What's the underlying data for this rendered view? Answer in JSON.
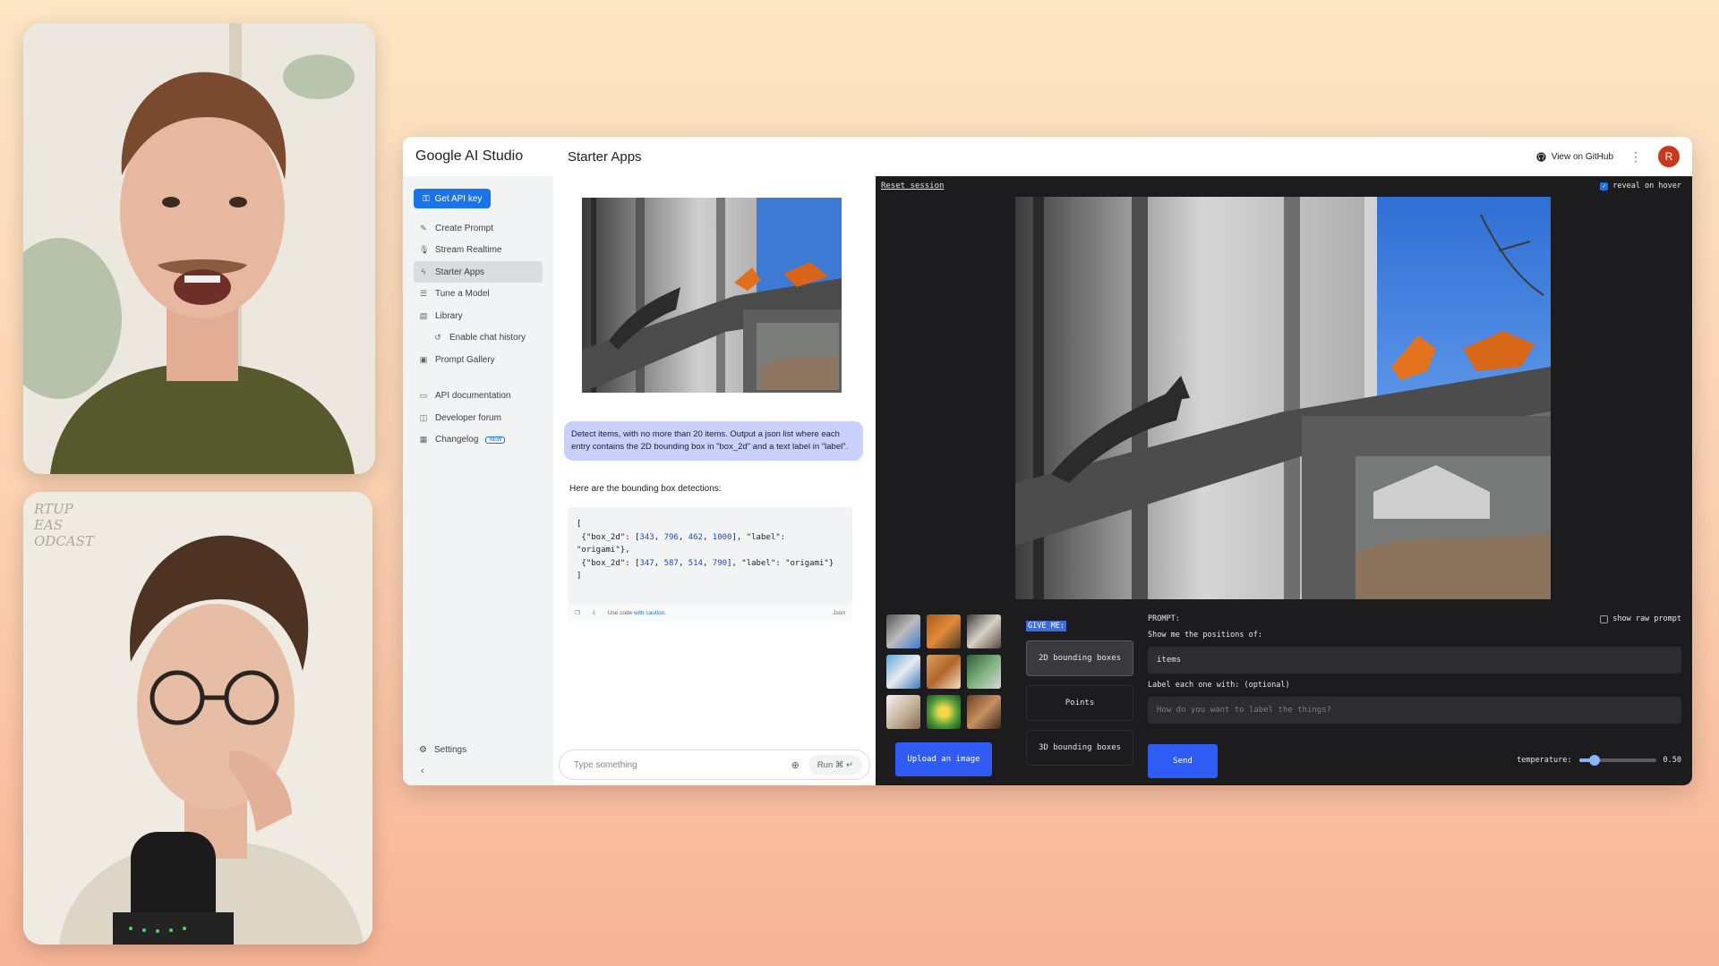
{
  "app": {
    "brand": "Google AI Studio",
    "page_title": "Starter Apps",
    "github_label": "View on GitHub",
    "avatar_initial": "R"
  },
  "sidebar": {
    "api_key_label": "Get API key",
    "items": [
      {
        "label": "Create Prompt",
        "icon": "create-prompt-icon"
      },
      {
        "label": "Stream Realtime",
        "icon": "microphone-icon"
      },
      {
        "label": "Starter Apps",
        "icon": "bolt-icon",
        "active": true
      },
      {
        "label": "Tune a Model",
        "icon": "tune-icon"
      },
      {
        "label": "Library",
        "icon": "library-icon"
      },
      {
        "label": "Enable chat history",
        "icon": "history-icon"
      },
      {
        "label": "Prompt Gallery",
        "icon": "gallery-icon"
      },
      {
        "label": "API documentation",
        "icon": "docs-icon"
      },
      {
        "label": "Developer forum",
        "icon": "forum-icon"
      },
      {
        "label": "Changelog",
        "icon": "changelog-icon",
        "badge": "NEW"
      }
    ],
    "settings_label": "Settings"
  },
  "chat": {
    "user_message": "Detect items, with no more than 20 items. Output a json list where each entry contains the 2D bounding box in \"box_2d\" and a text label in \"label\".",
    "model_intro": "Here are the bounding box detections:",
    "code": {
      "open": "[",
      "line1_pre": "{\"box_2d\": [",
      "line1_nums": [
        "343",
        "796",
        "462",
        "1000"
      ],
      "line1_post": "], \"label\":",
      "line1_cont": "\"origami\"},",
      "line2_pre": "{\"box_2d\": [",
      "line2_nums": [
        "347",
        "587",
        "514",
        "790"
      ],
      "line2_post": "], \"label\": \"origami\"}",
      "close": "]"
    },
    "code_footer_prefix": "Use code",
    "code_footer_link": "with caution.",
    "code_lang": "Json",
    "composer_placeholder": "Type something",
    "run_label": "Run",
    "run_shortcut": "⌘ ↵"
  },
  "starter": {
    "reset_label": "Reset session",
    "reveal_label": "reveal on hover",
    "give_me_label": "GIVE ME:",
    "modes": [
      "2D bounding boxes",
      "Points",
      "3D bounding boxes"
    ],
    "upload_label": "Upload an image",
    "prompt_label": "PROMPT:",
    "show_raw_label": "show raw prompt",
    "positions_label": "Show me the positions of:",
    "positions_value": "items",
    "label_each_label": "Label each one with: (optional)",
    "label_placeholder": "How do you want to label the things?",
    "send_label": "Send",
    "temperature_label": "temperature:",
    "temperature_value": "0.50",
    "temperature": 0.5
  },
  "colors": {
    "accent_blue": "#1a73e8",
    "starter_bg": "#1c1c1e",
    "button_blue": "#2f5cf5",
    "user_bubble": "#c9d0fb",
    "avatar_red": "#c8381b"
  },
  "cam2_writing": "RTUP\nEAS\nODCAST"
}
